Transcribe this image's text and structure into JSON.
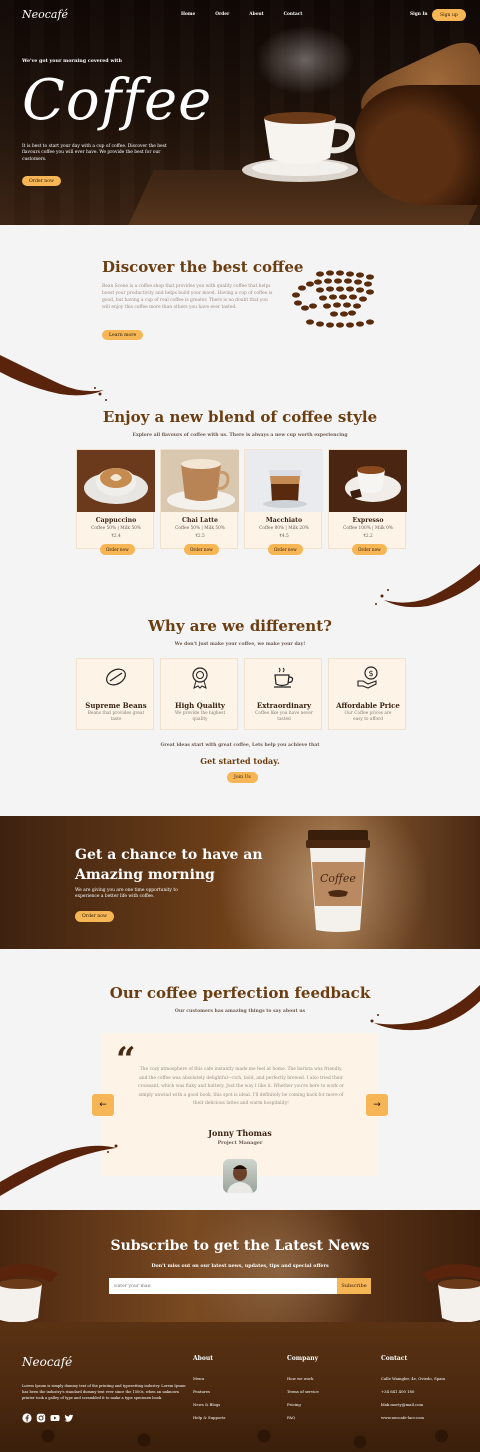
{
  "nav": {
    "logo": "Neocafé",
    "links": [
      "Home",
      "Order",
      "About",
      "Contact"
    ],
    "sign_in": "Sign In",
    "sign_up": "Sign up"
  },
  "hero": {
    "subtitle": "We've got your morning covered with",
    "title": "Coffee",
    "description": "It is best to start your day with a cup of coffee. Discover the best flavours coffee you will ever have. We provide the best for our customers.",
    "button": "Order now"
  },
  "discover": {
    "title": "Discover the best coffee",
    "text": "Bean Scene is a coffee shop that provides you with quality coffee that helps boost your productivity and helps build your mood. Having a cup of coffee is good, but having a cup of real coffee is greater. There is no doubt that you will enjoy this coffee more than others you have ever tasted.",
    "button": "Learn more"
  },
  "menu": {
    "title": "Enjoy a new blend of coffee style",
    "subtitle": "Explore all flavours of coffee with us. There is always a new cup worth experiencing",
    "items": [
      {
        "name": "Cappuccino",
        "desc": "Coffee 50% | Milk 50%",
        "price": "₹2.4",
        "button": "Order now"
      },
      {
        "name": "Chai Latte",
        "desc": "Coffee 50% | Milk 50%",
        "price": "₹2.5",
        "button": "Order now"
      },
      {
        "name": "Macchiato",
        "desc": "Coffee 80% | Milk 20%",
        "price": "₹4.5",
        "button": "Order now"
      },
      {
        "name": "Expresso",
        "desc": "Coffee 100% | Milk 0%",
        "price": "₹2.2",
        "button": "Order now"
      }
    ]
  },
  "different": {
    "title": "Why are we different?",
    "subtitle": "We don't just make your coffee, we make your day!",
    "features": [
      {
        "name": "Supreme Beans",
        "desc": "Beans that provides great taste",
        "icon": "beans-icon"
      },
      {
        "name": "High Quality",
        "desc": "We provide the highest quality",
        "icon": "medal-icon"
      },
      {
        "name": "Extraordinary",
        "desc": "Coffee like you have never tasted",
        "icon": "coffee-cup-icon"
      },
      {
        "name": "Affordable Price",
        "desc": "Our Coffee prices are easy to afford",
        "icon": "price-icon"
      }
    ],
    "cta_text": "Great ideas start with great coffee, Lets help you achieve that",
    "cta_title": "Get started today.",
    "cta_button": "Join Us"
  },
  "promo": {
    "title": "Get a chance to have an Amazing morning",
    "description": "We are giving you are one time opportunity to experience a better life with coffee.",
    "button": "Order now",
    "cup_label": "Coffee"
  },
  "feedback": {
    "title": "Our coffee perfection feedback",
    "subtitle": "Our customers has amazing things to say about us",
    "quote": "The cozy atmosphere of this cafe instantly made me feel at home. The barista was friendly, and the coffee was absolutely delightful—rich, bold, and perfectly brewed. I also tried their croissant, which was flaky and buttery. Just the way I like it. Whether you're here to work or simply unwind with a good book, this spot is ideal. I'll definitely be coming back for more of their delicious lattes and warm hospitality!",
    "name": "Jonny Thomas",
    "role": "Project Manager",
    "prev": "←",
    "next": "→"
  },
  "subscribe": {
    "title": "Subscribe to get the Latest News",
    "subtitle": "Don't miss out on our latest news, updates, tips and special offers",
    "placeholder": "Enter your mail",
    "button": "Subscribe"
  },
  "footer": {
    "logo": "Neocafé",
    "description": "Lorem Ipsum is simply dummy text of the printing and typesetting industry. Lorem Ipsum has been the industry's standard dummy text ever since the 1500s, when an unknown printer took a galley of type and scrambled it to make a type specimen book.",
    "columns": [
      {
        "heading": "About",
        "items": [
          "Menu",
          "Features",
          "News & Blogs",
          "Help & Supports"
        ]
      },
      {
        "heading": "Company",
        "items": [
          "How we work",
          "Terms of service",
          "Pricing",
          "FAQ"
        ]
      },
      {
        "heading": "Contact",
        "items": [
          "Calle Wamgler, 4e, Oviedo, Spain",
          "+34 641 400 180",
          "blak.morty@mail.com",
          "www.neocafe-lacr.com"
        ]
      }
    ]
  },
  "colors": {
    "accent": "#f6b655",
    "heading_brown": "#6b3e12",
    "card_bg": "#fdf4e7"
  }
}
